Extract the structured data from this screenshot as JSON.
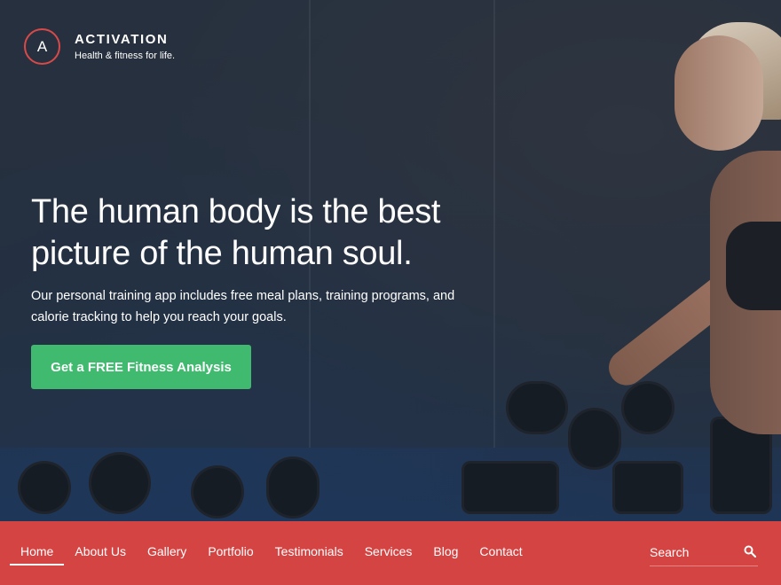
{
  "brand": {
    "logo_letter": "A",
    "title": "ACTIVATION",
    "tagline": "Health & fitness for life."
  },
  "hero": {
    "headline": "The human body is the best picture of the human soul.",
    "subtext": "Our personal training app includes free meal plans, training programs, and calorie tracking to help you reach your goals.",
    "cta_label": "Get a FREE Fitness Analysis"
  },
  "nav": {
    "items": [
      {
        "label": "Home",
        "active": true
      },
      {
        "label": "About Us",
        "active": false
      },
      {
        "label": "Gallery",
        "active": false
      },
      {
        "label": "Portfolio",
        "active": false
      },
      {
        "label": "Testimonials",
        "active": false
      },
      {
        "label": "Services",
        "active": false
      },
      {
        "label": "Blog",
        "active": false
      },
      {
        "label": "Contact",
        "active": false
      }
    ],
    "search_placeholder": "Search",
    "search_icon": "search-icon"
  },
  "colors": {
    "accent_red": "#d34443",
    "cta_green": "#3fba6e",
    "logo_ring": "#d84a49",
    "hero_overlay": "#26303e"
  }
}
